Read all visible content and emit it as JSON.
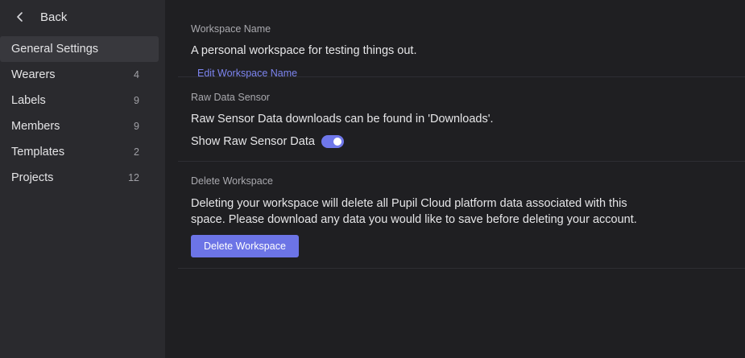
{
  "sidebar": {
    "back_label": "Back",
    "items": [
      {
        "label": "General Settings",
        "count": ""
      },
      {
        "label": "Wearers",
        "count": "4"
      },
      {
        "label": "Labels",
        "count": "9"
      },
      {
        "label": "Members",
        "count": "9"
      },
      {
        "label": "Templates",
        "count": "2"
      },
      {
        "label": "Projects",
        "count": "12"
      }
    ],
    "active_index": 0
  },
  "workspace_name": {
    "title": "Workspace Name",
    "value": "A personal workspace for testing things out.",
    "edit_label": "Edit Workspace Name"
  },
  "raw_data": {
    "title": "Raw Data Sensor",
    "description": "Raw Sensor Data downloads can be found in 'Downloads'.",
    "toggle_label": "Show Raw Sensor Data",
    "toggle_on": true
  },
  "delete": {
    "title": "Delete Workspace",
    "description": "Deleting your workspace will delete all Pupil Cloud platform data associated with this space. Please download any data you would like to save before deleting your account.",
    "button_label": "Delete Workspace"
  },
  "colors": {
    "accent": "#6c74e6",
    "link": "#7d85f0",
    "sidebar_bg": "#2a2a2e",
    "main_bg": "#1f1f22"
  }
}
